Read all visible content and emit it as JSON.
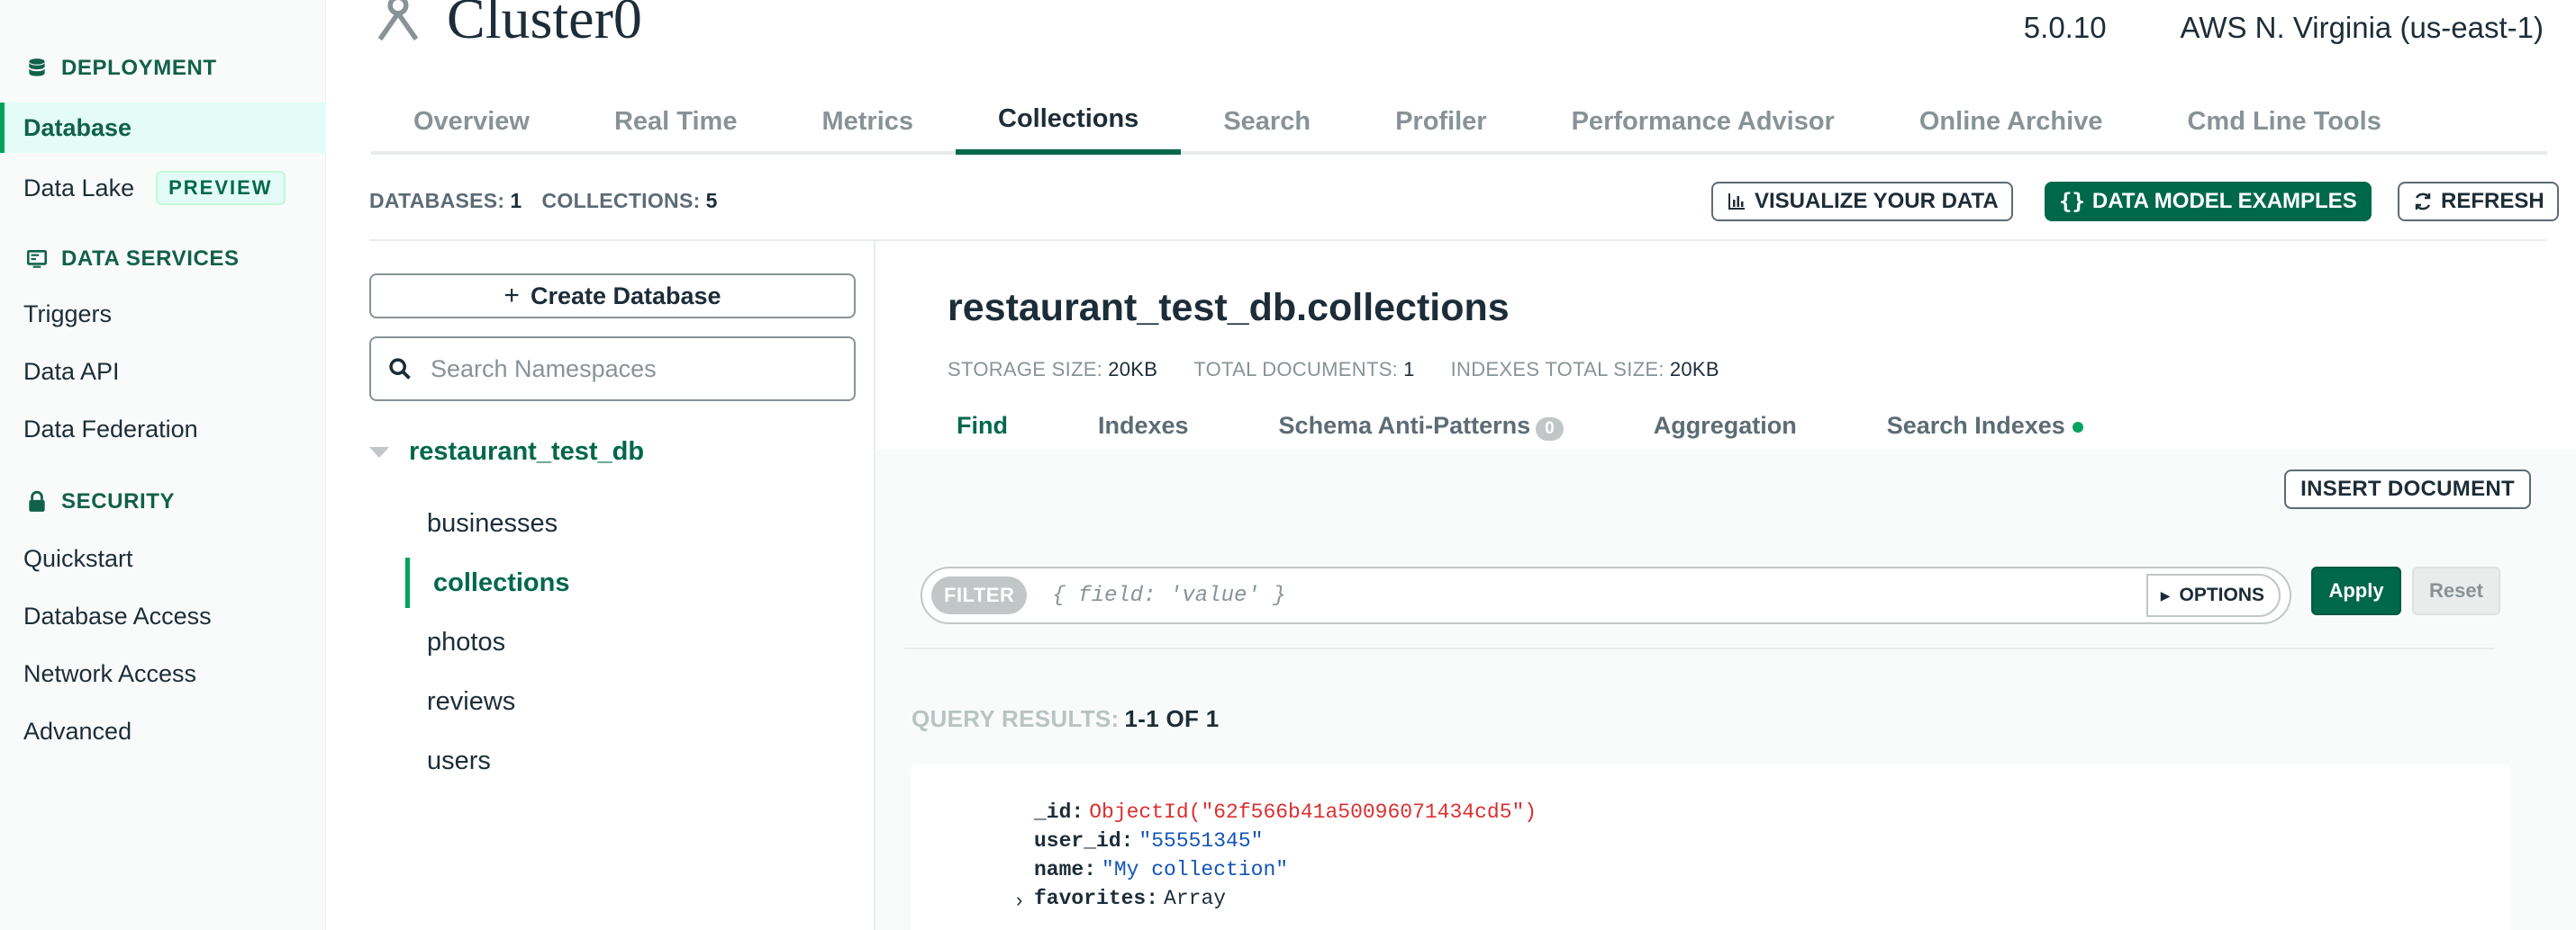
{
  "sidebar": {
    "deployment_label": "DEPLOYMENT",
    "database_label": "Database",
    "data_lake_label": "Data Lake",
    "preview_badge": "PREVIEW",
    "data_services_label": "DATA SERVICES",
    "triggers_label": "Triggers",
    "data_api_label": "Data API",
    "data_federation_label": "Data Federation",
    "security_label": "SECURITY",
    "quickstart_label": "Quickstart",
    "database_access_label": "Database Access",
    "network_access_label": "Network Access",
    "advanced_label": "Advanced"
  },
  "header": {
    "cluster_name": "Cluster0",
    "version": "5.0.10",
    "region": "AWS N. Virginia (us-east-1)"
  },
  "tabs": [
    "Overview",
    "Real Time",
    "Metrics",
    "Collections",
    "Search",
    "Profiler",
    "Performance Advisor",
    "Online Archive",
    "Cmd Line Tools"
  ],
  "active_tab": "Collections",
  "stats": {
    "databases_label": "DATABASES:",
    "databases_count": "1",
    "collections_label": "COLLECTIONS:",
    "collections_count": "5"
  },
  "toolbar": {
    "visualize_label": "VISUALIZE YOUR DATA",
    "data_model_label": "DATA MODEL EXAMPLES",
    "refresh_label": "REFRESH"
  },
  "db_panel": {
    "create_db_label": "Create Database",
    "search_placeholder": "Search Namespaces",
    "database_name": "restaurant_test_db",
    "collections": [
      "businesses",
      "collections",
      "photos",
      "reviews",
      "users"
    ],
    "active_collection": "collections"
  },
  "main": {
    "namespace_title": "restaurant_test_db.collections",
    "storage_size_label": "STORAGE SIZE:",
    "storage_size_value": "20KB",
    "total_documents_label": "TOTAL DOCUMENTS:",
    "total_documents_value": "1",
    "indexes_size_label": "INDEXES TOTAL SIZE:",
    "indexes_size_value": "20KB",
    "sub_tabs": {
      "find": "Find",
      "indexes": "Indexes",
      "schema": "Schema Anti-Patterns",
      "schema_count": "0",
      "aggregation": "Aggregation",
      "search_indexes": "Search Indexes"
    },
    "insert_document_label": "INSERT DOCUMENT",
    "filter_pill": "FILTER",
    "filter_placeholder": "{ field: 'value' }",
    "options_label": "OPTIONS",
    "apply_label": "Apply",
    "reset_label": "Reset",
    "query_results_label": "QUERY RESULTS:",
    "query_results_value": "1-1 OF 1",
    "document": {
      "id_key": "_id:",
      "id_value": "ObjectId(\"62f566b41a50096071434cd5\")",
      "user_id_key": "user_id:",
      "user_id_value": "\"55551345\"",
      "name_key": "name:",
      "name_value": "\"My collection\"",
      "favorites_key": "favorites:",
      "favorites_value": "Array"
    }
  },
  "colors": {
    "brand_green": "#00684a",
    "accent_green": "#00a35c",
    "sidebar_bg": "#f9fbfa",
    "active_bg": "#e3fcf7",
    "objectid_red": "#db3030",
    "string_blue": "#1254b7"
  }
}
